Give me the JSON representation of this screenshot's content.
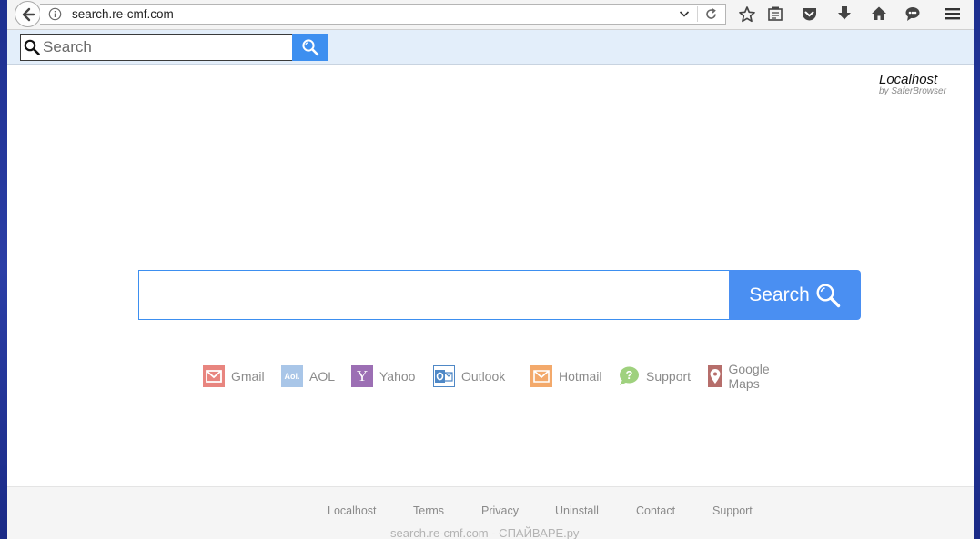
{
  "browser": {
    "url": "search.re-cmf.com"
  },
  "toolbar": {
    "search_placeholder": "Search"
  },
  "brand": {
    "title": "Localhost",
    "subtitle": "by SaferBrowser"
  },
  "main_search": {
    "value": "",
    "button_label": "Search"
  },
  "quick_links": [
    {
      "label": "Gmail",
      "color": "#e8857f"
    },
    {
      "label": "AOL",
      "color": "#a9c6e8"
    },
    {
      "label": "Yahoo",
      "color": "#9c6fb4"
    },
    {
      "label": "Outlook",
      "color": "#4f88c6"
    },
    {
      "label": "Hotmail",
      "color": "#f3a96b"
    },
    {
      "label": "Support",
      "color": "#9fd17e"
    },
    {
      "label": "Google Maps",
      "color": "#b66e6b"
    }
  ],
  "footer": {
    "links": [
      "Localhost",
      "Terms",
      "Privacy",
      "Uninstall",
      "Contact",
      "Support"
    ]
  },
  "watermark": "search.re-cmf.com - СПАЙВАРЕ.ру",
  "colors": {
    "accent": "#4a8ff2",
    "toolbar_bg": "#e3eefa"
  }
}
